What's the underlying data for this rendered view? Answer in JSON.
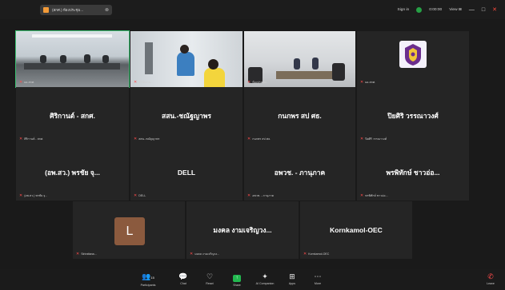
{
  "window": {
    "tab_title": "‌‌(สกศ.) ห้องประชุม...",
    "tab_close": "⊗",
    "sign_in": "Sign in",
    "timer": "0:00:00",
    "view_label": "View",
    "min_btn": "—",
    "max_btn": "□",
    "close_btn": "✕"
  },
  "tiles": [
    {
      "id": "t1",
      "name": "",
      "footer": "ผอ.สกศ."
    },
    {
      "id": "t2",
      "name": "",
      "footer": "สำนักงาน..."
    },
    {
      "id": "t3",
      "name": "",
      "footer": "ห้องประชุม..."
    },
    {
      "id": "t4",
      "name": "",
      "footer": "ผอ.สกศ."
    },
    {
      "id": "t5",
      "name": "ศิริกานต์ - สกศ.",
      "footer": "ศิริกานต์ - สกศ."
    },
    {
      "id": "t6",
      "name": "สสน.-ชณัฐญาพร",
      "footer": "สสน.-ชณัฐญาพร"
    },
    {
      "id": "t7",
      "name": "กนกพร สป ศธ.",
      "footer": "กนกพร สป ศธ."
    },
    {
      "id": "t8",
      "name": "ปิยศิริ วรรณาวงศ์",
      "footer": "ปิยศิริ วรรณาวงศ์"
    },
    {
      "id": "t9",
      "name": "(อพ.สว.) พรชัย จุ...",
      "footer": "(อพ.สว.) พรชัย จุ..."
    },
    {
      "id": "t10",
      "name": "DELL",
      "footer": "DELL"
    },
    {
      "id": "t11",
      "name": "อพวช. - ภานุภาค",
      "footer": "อพวช. - ภานุภาค"
    },
    {
      "id": "t12",
      "name": "พรพิทักษ์ ชาวอ่อ...",
      "footer": "พรพิทักษ์ ชาวอ่อ..."
    },
    {
      "id": "t13",
      "name": "",
      "avatar": "L",
      "footer": "Sirirattana..."
    },
    {
      "id": "t14",
      "name": "มงคล งามเจริญวง...",
      "footer": "มงคล งามเจริญวง..."
    },
    {
      "id": "t15",
      "name": "Kornkamol-OEC",
      "footer": "Kornkamol-OEC"
    }
  ],
  "toolbar": {
    "participants_count": "15",
    "items": [
      {
        "label": "Participants",
        "icon": "👥"
      },
      {
        "label": "Chat",
        "icon": "💬"
      },
      {
        "label": "React",
        "icon": "♡"
      },
      {
        "label": "Share",
        "icon": "↑"
      },
      {
        "label": "AI Companion",
        "icon": "✦"
      },
      {
        "label": "Apps",
        "icon": "⊞"
      },
      {
        "label": "More",
        "icon": "⋯"
      },
      {
        "label": "Leave",
        "icon": "✆"
      }
    ]
  },
  "mic_muted_icon": "✕"
}
